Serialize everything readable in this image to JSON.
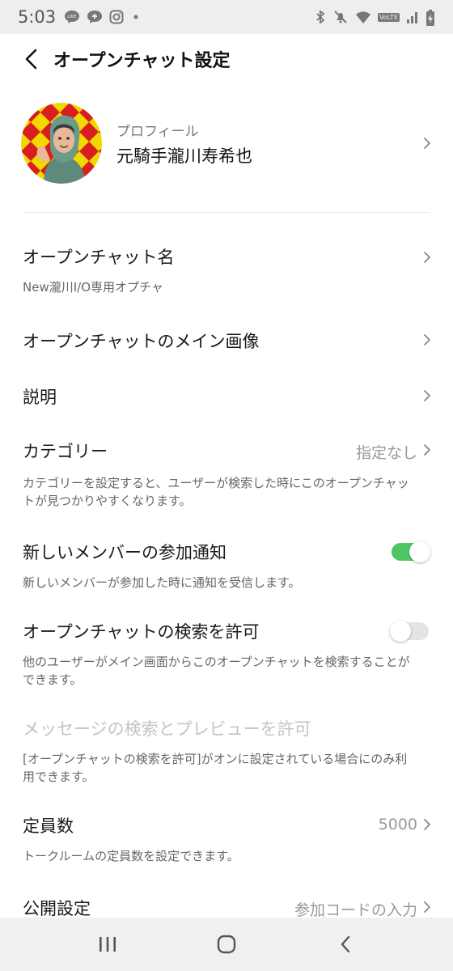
{
  "status_bar": {
    "time": "5:03",
    "left_icons": [
      "line-icon",
      "chat-bubble-icon",
      "instagram-icon",
      "dot-icon"
    ],
    "right_icons": [
      "bluetooth-icon",
      "mute-icon",
      "wifi-icon",
      "volte-icon",
      "signal-icon",
      "battery-charging-icon"
    ],
    "volte_label": "VoLTE"
  },
  "header": {
    "title": "オープンチャット設定",
    "back_icon": "chevron-left-icon"
  },
  "profile": {
    "label": "プロフィール",
    "name": "元騎手瀧川寿希也"
  },
  "settings": {
    "openchat_name": {
      "title": "オープンチャット名",
      "value": "New瀧川I/O専用オプチャ"
    },
    "main_image": {
      "title": "オープンチャットのメイン画像"
    },
    "description": {
      "title": "説明"
    },
    "category": {
      "title": "カテゴリー",
      "value": "指定なし",
      "sub": "カテゴリーを設定すると、ユーザーが検索した時にこのオープンチャットが見つかりやすくなります。"
    },
    "new_member_notify": {
      "title": "新しいメンバーの参加通知",
      "sub": "新しいメンバーが参加した時に通知を受信します。",
      "enabled": true
    },
    "allow_search": {
      "title": "オープンチャットの検索を許可",
      "sub": "他のユーザーがメイン画面からこのオープンチャットを検索することができます。",
      "enabled": false
    },
    "message_search": {
      "title": "メッセージの検索とプレビューを許可",
      "sub": "[オープンチャットの検索を許可]がオンに設定されている場合にのみ利用できます。"
    },
    "capacity": {
      "title": "定員数",
      "value": "5000",
      "sub": "トークルームの定員数を設定できます。"
    },
    "visibility": {
      "title": "公開設定",
      "value": "参加コードの入力"
    }
  },
  "nav_bar": {
    "icons": [
      "recent-apps-icon",
      "home-icon",
      "back-icon"
    ]
  },
  "colors": {
    "toggle_on": "#4cc764",
    "toggle_off": "#e4e4e4",
    "status_bar_bg": "#eeeeee"
  }
}
